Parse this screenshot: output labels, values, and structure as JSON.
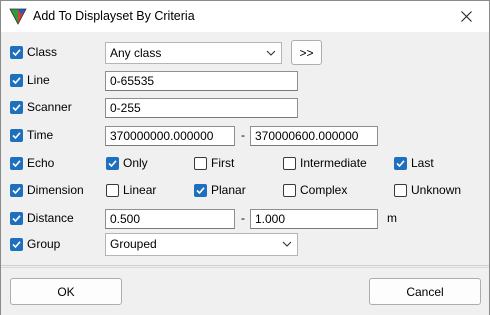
{
  "window": {
    "title": "Add To Displayset By Criteria",
    "accent_color": "#1f6fbf"
  },
  "class": {
    "checked": true,
    "label": "Class",
    "select_value": "Any class",
    "more_button": ">>"
  },
  "line": {
    "checked": true,
    "label": "Line",
    "value": "0-65535"
  },
  "scanner": {
    "checked": true,
    "label": "Scanner",
    "value": "0-255"
  },
  "time": {
    "checked": true,
    "label": "Time",
    "from": "370000000.000000",
    "separator": "-",
    "to": "370000600.000000"
  },
  "echo": {
    "checked": true,
    "label": "Echo",
    "options": [
      {
        "label": "Only",
        "checked": true
      },
      {
        "label": "First",
        "checked": false
      },
      {
        "label": "Intermediate",
        "checked": false
      },
      {
        "label": "Last",
        "checked": true
      }
    ]
  },
  "dimension": {
    "checked": true,
    "label": "Dimension",
    "options": [
      {
        "label": "Linear",
        "checked": false
      },
      {
        "label": "Planar",
        "checked": true
      },
      {
        "label": "Complex",
        "checked": false
      },
      {
        "label": "Unknown",
        "checked": false
      }
    ]
  },
  "distance": {
    "checked": true,
    "label": "Distance",
    "from": "0.500",
    "separator": "-",
    "to": "1.000",
    "unit": "m"
  },
  "group": {
    "checked": true,
    "label": "Group",
    "select_value": "Grouped"
  },
  "buttons": {
    "ok": "OK",
    "cancel": "Cancel"
  }
}
